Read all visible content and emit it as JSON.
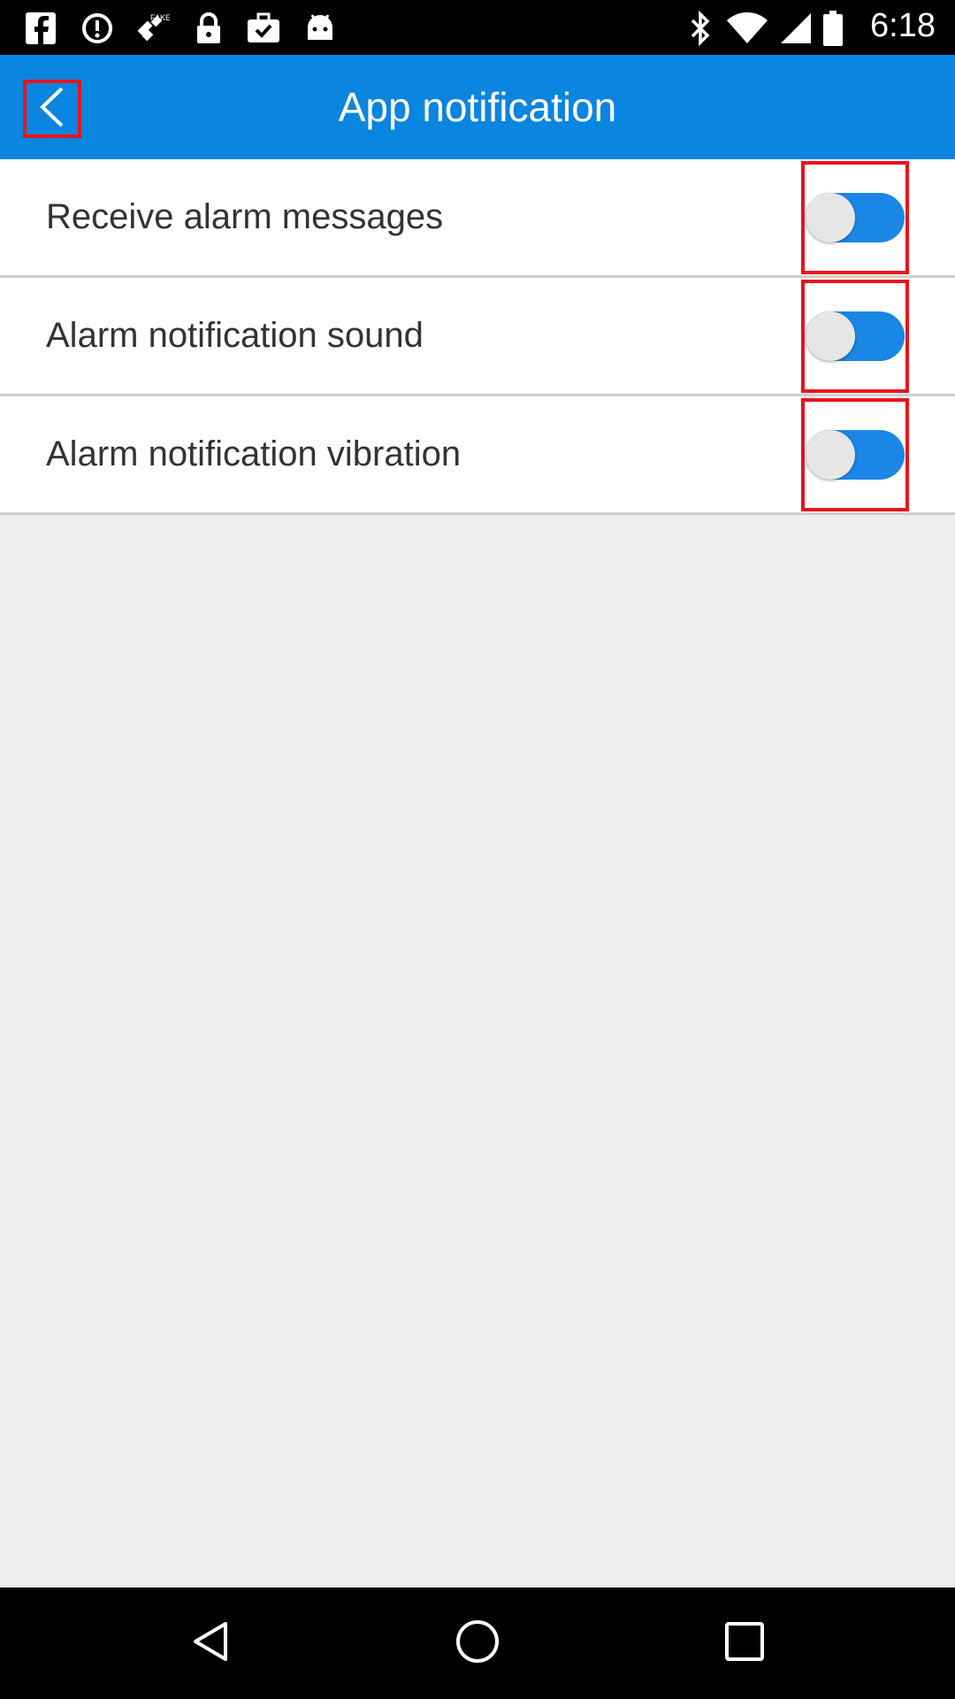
{
  "status_bar": {
    "time": "6:18",
    "left_icons": [
      "facebook-icon",
      "sync-icon",
      "fake-gps-icon",
      "lock-icon",
      "briefcase-check-icon",
      "android-icon"
    ],
    "right_icons": [
      "bluetooth-icon",
      "wifi-icon",
      "signal-icon",
      "battery-icon"
    ]
  },
  "app_bar": {
    "title": "App notification",
    "back_icon": "chevron-left-icon"
  },
  "settings": [
    {
      "label": "Receive alarm messages",
      "enabled": true
    },
    {
      "label": "Alarm notification sound",
      "enabled": true
    },
    {
      "label": "Alarm notification vibration",
      "enabled": true
    }
  ],
  "nav_bar": {
    "icons": [
      "back-triangle-icon",
      "home-circle-icon",
      "recents-square-icon"
    ]
  },
  "colors": {
    "app_bar": "#0a85e0",
    "toggle_track": "#1a87e6",
    "highlight": "#e8141c",
    "background": "#eeeeee"
  }
}
